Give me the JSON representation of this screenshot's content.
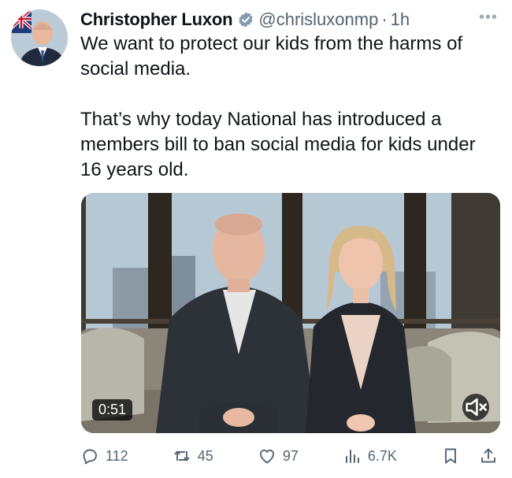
{
  "author": {
    "display_name": "Christopher Luxon",
    "handle": "@chrisluxonmp",
    "separator": "·",
    "time": "1h",
    "verified_color": "#829aab"
  },
  "tweet": {
    "text": "We want to protect our kids from the harms of\nsocial media.\n\nThat’s why today National has introduced a\nmembers bill to ban social media for kids under\n16 years old."
  },
  "media": {
    "type": "video",
    "duration": "0:51",
    "muted": true
  },
  "actions": {
    "replies": "112",
    "reposts": "45",
    "likes": "97",
    "views": "6.7K"
  },
  "colors": {
    "text_primary": "#0f1419",
    "text_secondary": "#536471"
  }
}
